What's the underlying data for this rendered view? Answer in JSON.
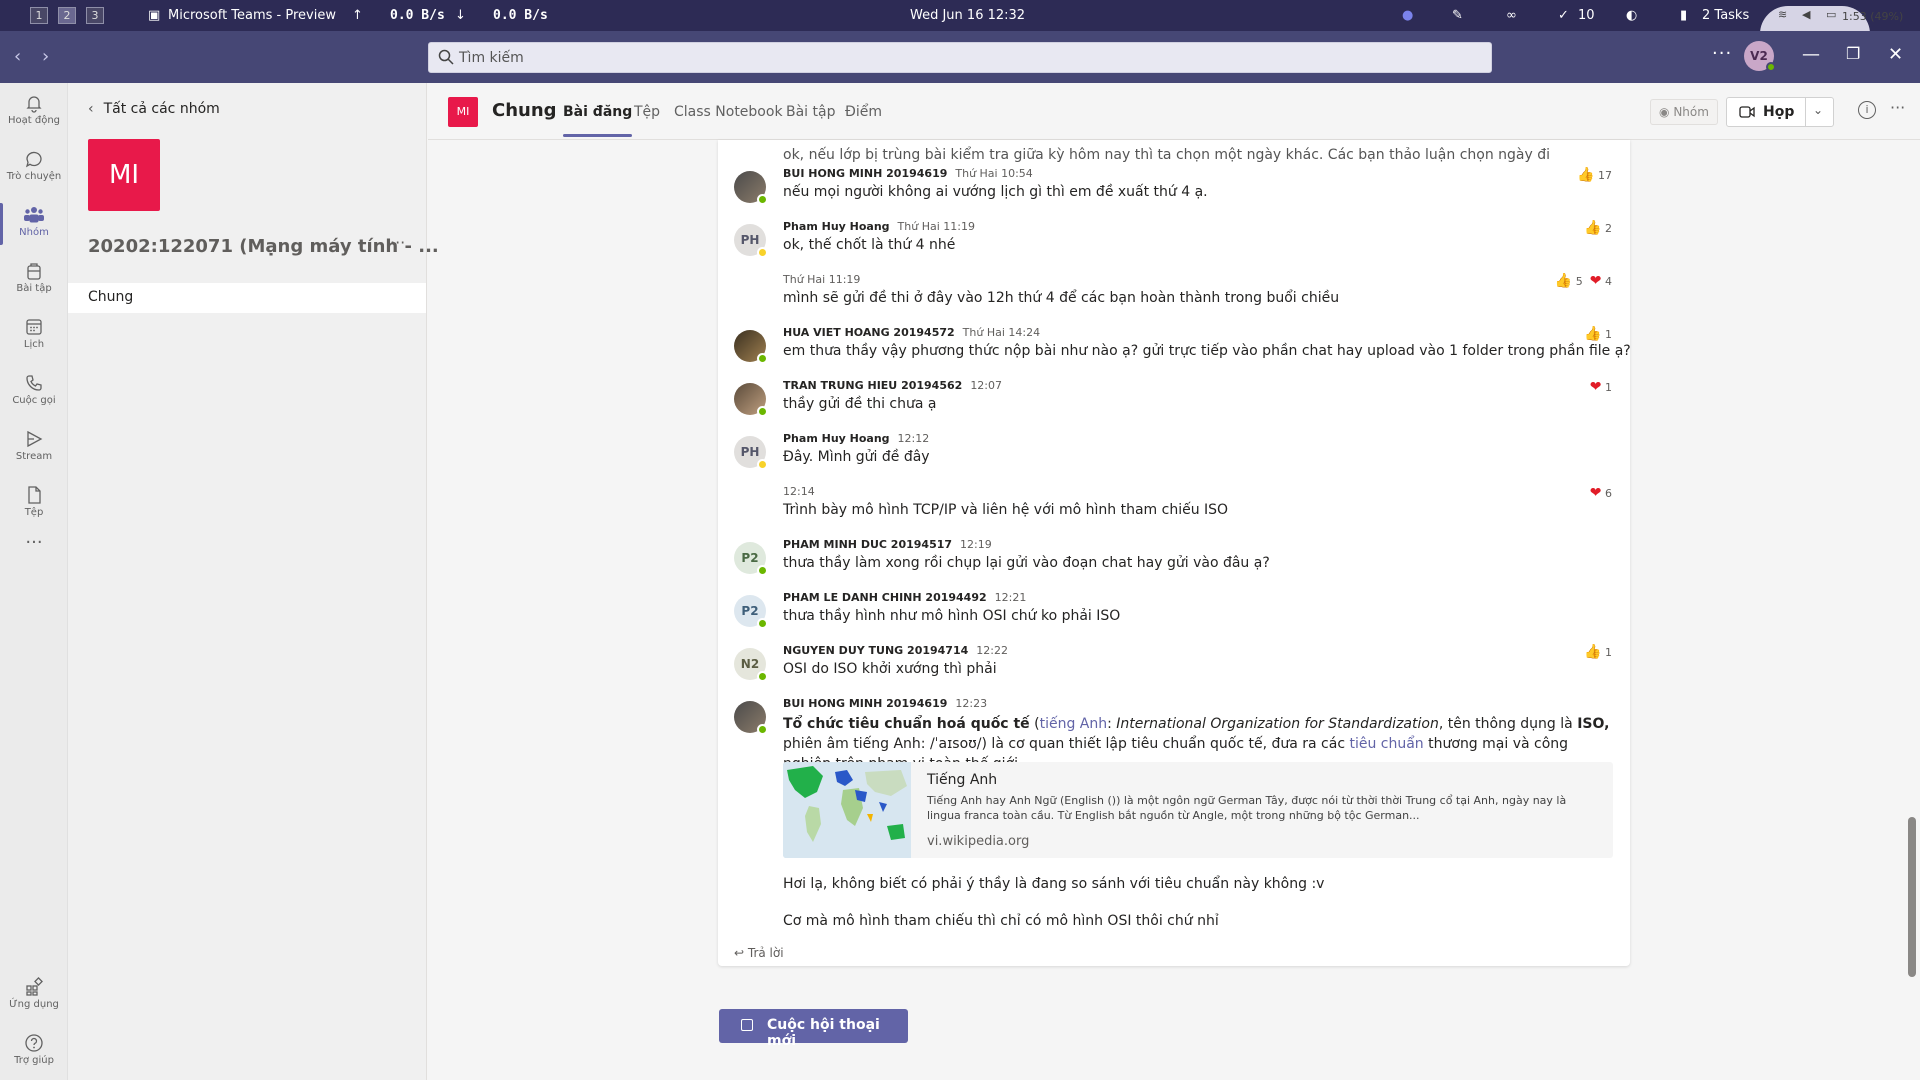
{
  "sysbar": {
    "workspaces": [
      "1",
      "2",
      "3"
    ],
    "app_title": "Microsoft Teams - Preview",
    "net_up": "0.0  B/s",
    "net_down": "0.0  B/s",
    "datetime": "Wed Jun 16  12:32",
    "count": "10",
    "tasks": "2 Tasks",
    "battery": "1:53 (49%)"
  },
  "titlebar": {
    "search_placeholder": "Tìm kiếm",
    "more": "···",
    "avatar_initials": "V2"
  },
  "rail": [
    {
      "label": "Hoạt động",
      "icon": "bell-icon"
    },
    {
      "label": "Trò chuyện",
      "icon": "chat-icon"
    },
    {
      "label": "Nhóm",
      "icon": "teams-icon"
    },
    {
      "label": "Bài tập",
      "icon": "assignments-icon"
    },
    {
      "label": "Lịch",
      "icon": "calendar-icon"
    },
    {
      "label": "Cuộc gọi",
      "icon": "phone-icon"
    },
    {
      "label": "Stream",
      "icon": "stream-icon"
    },
    {
      "label": "Tệp",
      "icon": "file-icon"
    },
    {
      "label": "Ứng dụng",
      "icon": "apps-icon"
    },
    {
      "label": "Trợ giúp",
      "icon": "help-icon"
    }
  ],
  "team": {
    "back_label": "Tất cả các nhóm",
    "initials": "MI",
    "name": "20202:122071 (Mạng máy tính - ...",
    "channel": "Chung"
  },
  "channel_header": {
    "initials": "MI",
    "name": "Chung",
    "tabs": [
      "Bài đăng",
      "Tệp",
      "Class Notebook",
      "Bài tập",
      "Điểm"
    ],
    "team_badge": "Nhóm",
    "meet_label": "Họp"
  },
  "messages": [
    {
      "author": "BUI HONG MINH 20194619",
      "time": "Thứ Hai 10:54",
      "text": "nếu mọi người không ai vướng lịch gì thì em đề xuất thứ 4 ạ.",
      "likes": "17"
    },
    {
      "author": "Pham Huy Hoang",
      "time": "Thứ Hai 11:19",
      "initials": "PH",
      "text": "ok, thế chốt là thứ 4 nhé",
      "likes": "2"
    },
    {
      "time": "Thứ Hai 11:19",
      "text": "mình sẽ gửi đề thi ở đây vào 12h thứ 4 để các bạn hoàn thành trong buổi chiều",
      "likes": "5",
      "hearts": "4"
    },
    {
      "author": "HUA VIET HOANG 20194572",
      "time": "Thứ Hai 14:24",
      "text": "em thưa thầy vậy phương thức nộp bài như nào ạ? gửi trực tiếp vào phần chat hay upload vào 1 folder trong phần file ạ?",
      "likes": "1"
    },
    {
      "author": "TRAN TRUNG HIEU 20194562",
      "time": "12:07",
      "text": "thầy gửi đề thi chưa ạ",
      "hearts": "1"
    },
    {
      "author": "Pham Huy Hoang",
      "time": "12:12",
      "initials": "PH",
      "text": "Đây. Mình gửi đề đây"
    },
    {
      "time": "12:14",
      "text": "Trình bày mô hình TCP/IP và liên hệ với mô hình tham chiếu ISO",
      "hearts": "6"
    },
    {
      "author": "PHAM MINH DUC 20194517",
      "time": "12:19",
      "initials": "P2",
      "text": "thưa thầy làm xong rồi chụp lại gửi vào đoạn chat hay gửi vào đâu ạ?"
    },
    {
      "author": "PHAM LE DANH CHINH 20194492",
      "time": "12:21",
      "initials": "P2",
      "text": "thưa thầy hình như mô hình OSI chứ ko phải ISO"
    },
    {
      "author": "NGUYEN DUY TUNG 20194714",
      "time": "12:22",
      "initials": "N2",
      "text": "OSI do ISO khởi xướng thì phải",
      "likes": "1"
    }
  ],
  "last_message": {
    "author": "BUI HONG MINH 20194619",
    "time": "12:23",
    "p1_bold": "Tổ chức tiêu chuẩn hoá quốc tế",
    "p1_a": " (",
    "p1_link1": "tiếng Anh",
    "p1_b": ": ",
    "p1_italic": "International Organization for Standardization",
    "p1_c": ", tên thông dụng là ",
    "p1_iso": "ISO,",
    "p1_d": " phiên âm tiếng Anh: /ˈaɪsoʊ/) là cơ quan thiết lập tiêu chuẩn quốc tế, đưa ra các ",
    "p1_link2": "tiêu chuẩn",
    "p1_e": " thương mại và công nghiệp trên phạm vi toàn thế giới.",
    "preview_title": "Tiếng Anh",
    "preview_desc": "Tiếng Anh hay Anh Ngữ (English ()) là một ngôn ngữ German Tây, được nói từ thời thời Trung cổ tại Anh, ngày nay là lingua franca toàn cầu. Từ English bắt nguồn từ Angle, một trong những bộ tộc German...",
    "preview_url": "vi.wikipedia.org",
    "line2": "Hơi lạ, không biết có phải ý thầy là đang so sánh với tiêu chuẩn này không :v",
    "line3": "Cơ mà mô hình tham chiếu thì chỉ có mô hình OSI thôi chứ nhỉ"
  },
  "partial_top": "ok, nếu lớp bị trùng bài kiểm tra giữa kỳ hôm nay thì ta chọn một ngày khác. Các bạn thảo luận chọn ngày đi",
  "reply_label": "Trả lời",
  "new_conversation": "Cuộc hội thoại mới",
  "colors": {
    "accent": "#6264a7",
    "team_tile": "#e8194a",
    "titlebar": "#464775"
  }
}
